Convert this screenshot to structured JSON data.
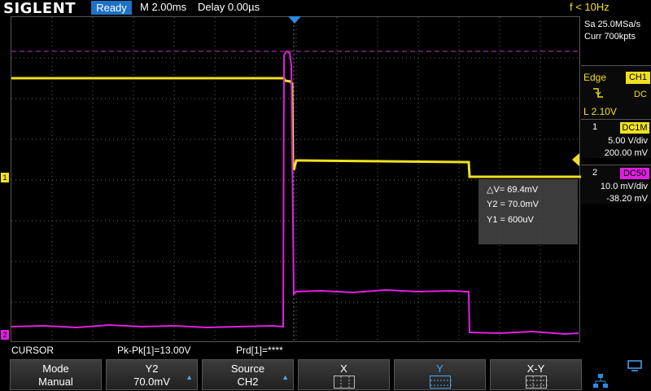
{
  "brand": "SIGLENT",
  "status": {
    "run_state": "Ready",
    "timebase": "M 2.00ms",
    "delay": "Delay 0.00µs",
    "frequency": "f < 10Hz"
  },
  "acquisition": {
    "sample_rate": "Sa 25.0MSa/s",
    "memory": "Curr 700kpts"
  },
  "trigger": {
    "type": "Edge",
    "source": "CH1",
    "slope_icon": "falling-edge-icon",
    "coupling": "DC",
    "level": "L  2.10V"
  },
  "channels": [
    {
      "number": "1",
      "coupling": "DC1M",
      "scale": "5.00 V/div",
      "offset": "200.00 mV",
      "color": "#f0e020"
    },
    {
      "number": "2",
      "coupling": "DC50",
      "scale": "10.0 mV/div",
      "offset": "-38.20 mV",
      "color": "#e020e0"
    }
  ],
  "cursor_readout": {
    "delta": "△V= 69.4mV",
    "y2": "Y2 = 70.0mV",
    "y1": "Y1 = 600uV"
  },
  "measurements": {
    "menu": "CURSOR",
    "pkpk": "Pk-Pk[1]=13.00V",
    "prd": "Prd[1]=****"
  },
  "softkeys": [
    {
      "line1": "Mode",
      "line2": "Manual"
    },
    {
      "line1": "Y2",
      "line2": "70.0mV"
    },
    {
      "line1": "Source",
      "line2": "CH2"
    },
    {
      "line1": "X"
    },
    {
      "line1": "Y"
    },
    {
      "line1": "X-Y"
    }
  ],
  "icons": {
    "network": "network-icon",
    "usb": "usb-icon"
  }
}
